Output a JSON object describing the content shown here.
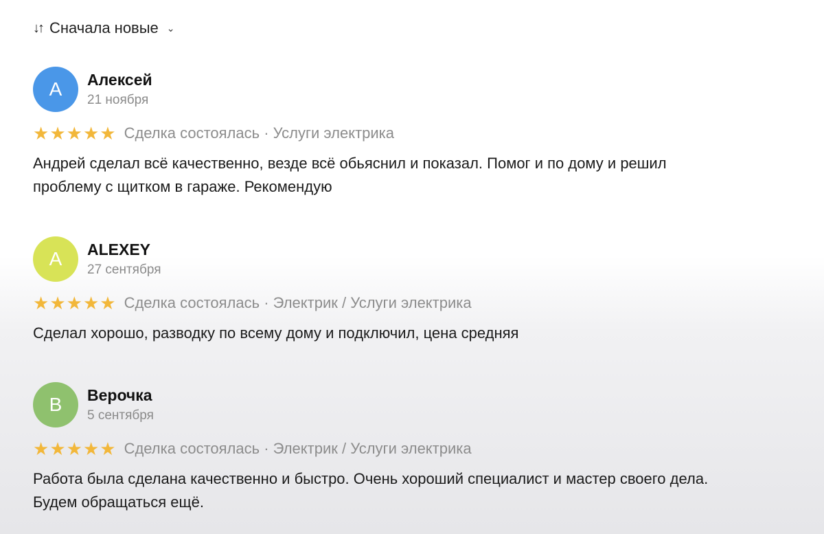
{
  "sort": {
    "icon": "sort-arrows-icon",
    "label": "Сначала новые",
    "chevron": "chevron-down-icon"
  },
  "colors": {
    "star": "#f2b73a",
    "avatar_blue": "#4a97e8",
    "avatar_yellow": "#d8e357",
    "avatar_green": "#8fc16e"
  },
  "reviews": [
    {
      "initial": "А",
      "name": "Алексей",
      "date": "21 ноября",
      "tags": "Сделка состоялась · Услуги электрика",
      "text": "Андрей сделал всё качественно, везде всё обьяснил и показал. Помог и по дому и решил\nпроблему с щитком в гараже. Рекомендую"
    },
    {
      "initial": "A",
      "name": "ALEXEY",
      "date": "27 сентября",
      "tags": "Сделка состоялась · Электрик / Услуги электрика",
      "text": "Сделал хорошо, разводку по всему дому и подключил, цена средняя"
    },
    {
      "initial": "В",
      "name": "Верочка",
      "date": "5 сентября",
      "tags": "Сделка состоялась · Электрик / Услуги электрика",
      "text": "Работа была сделана качественно и быстро. Очень хороший специалист и мастер своего дела.\nБудем обращаться ещё."
    }
  ]
}
